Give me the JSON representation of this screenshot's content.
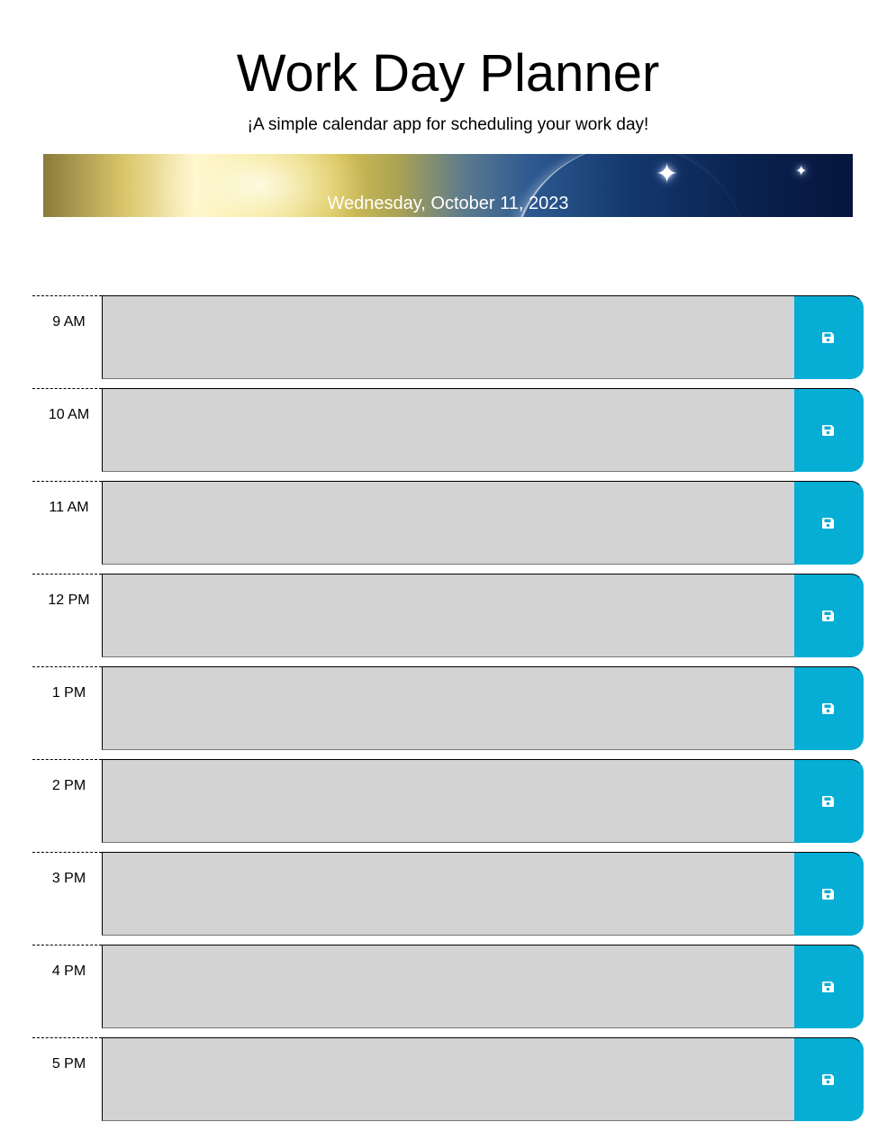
{
  "header": {
    "title": "Work Day Planner",
    "subtitle": "¡A simple calendar app for scheduling your work day!"
  },
  "jumbotron": {
    "current_date": "Wednesday, October 11, 2023"
  },
  "colors": {
    "textarea_background": "#d3d3d3",
    "save_button": "#06aed5",
    "save_icon": "#ffffff"
  },
  "timeblocks": [
    {
      "hour": "9 AM",
      "description": "",
      "save_icon": "floppy-disk-icon"
    },
    {
      "hour": "10 AM",
      "description": "",
      "save_icon": "floppy-disk-icon"
    },
    {
      "hour": "11 AM",
      "description": "",
      "save_icon": "floppy-disk-icon"
    },
    {
      "hour": "12 PM",
      "description": "",
      "save_icon": "floppy-disk-icon"
    },
    {
      "hour": "1 PM",
      "description": "",
      "save_icon": "floppy-disk-icon"
    },
    {
      "hour": "2 PM",
      "description": "",
      "save_icon": "floppy-disk-icon"
    },
    {
      "hour": "3 PM",
      "description": "",
      "save_icon": "floppy-disk-icon"
    },
    {
      "hour": "4 PM",
      "description": "",
      "save_icon": "floppy-disk-icon"
    },
    {
      "hour": "5 PM",
      "description": "",
      "save_icon": "floppy-disk-icon"
    }
  ]
}
